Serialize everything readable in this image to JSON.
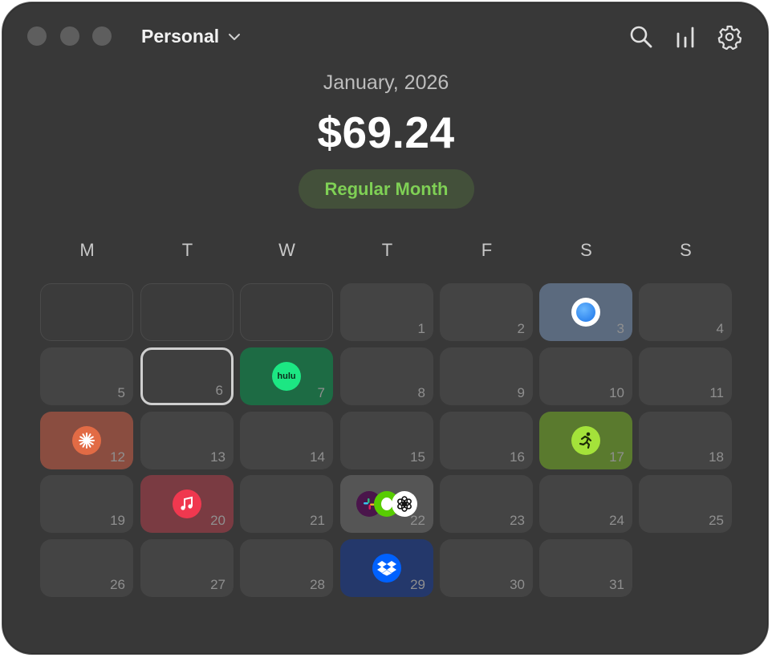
{
  "header": {
    "account_label": "Personal",
    "icons": [
      "search-icon",
      "stats-icon",
      "settings-icon"
    ]
  },
  "summary": {
    "month_label": "January, 2026",
    "total": "$69.24",
    "status": "Regular Month"
  },
  "calendar": {
    "weekdays": [
      "M",
      "T",
      "W",
      "T",
      "F",
      "S",
      "S"
    ],
    "days": [
      {
        "n": "1"
      },
      {
        "n": "2"
      },
      {
        "n": "3",
        "service": "circle-app-icon",
        "color": "#5b6a7e"
      },
      {
        "n": "4"
      },
      {
        "n": "5"
      },
      {
        "n": "6",
        "today": true
      },
      {
        "n": "7",
        "service": "hulu-icon",
        "color": "#1d6b44",
        "label": "hulu"
      },
      {
        "n": "8"
      },
      {
        "n": "9"
      },
      {
        "n": "10"
      },
      {
        "n": "11"
      },
      {
        "n": "12",
        "service": "claude-icon",
        "color": "#8a4d40"
      },
      {
        "n": "13"
      },
      {
        "n": "14"
      },
      {
        "n": "15"
      },
      {
        "n": "16"
      },
      {
        "n": "17",
        "service": "fitness-icon",
        "color": "#5a7a2e"
      },
      {
        "n": "18"
      },
      {
        "n": "19"
      },
      {
        "n": "20",
        "service": "apple-music-icon",
        "color": "#7a3b42"
      },
      {
        "n": "21"
      },
      {
        "n": "22",
        "service": "multiple-apps-icon",
        "color": "#555555"
      },
      {
        "n": "23"
      },
      {
        "n": "24"
      },
      {
        "n": "25"
      },
      {
        "n": "26"
      },
      {
        "n": "27"
      },
      {
        "n": "28"
      },
      {
        "n": "29",
        "service": "dropbox-icon",
        "color": "#24386b"
      },
      {
        "n": "30"
      },
      {
        "n": "31"
      }
    ]
  },
  "colors": {
    "window_bg": "#383838",
    "pill_bg": "#43503a",
    "pill_text": "#7fd055"
  }
}
